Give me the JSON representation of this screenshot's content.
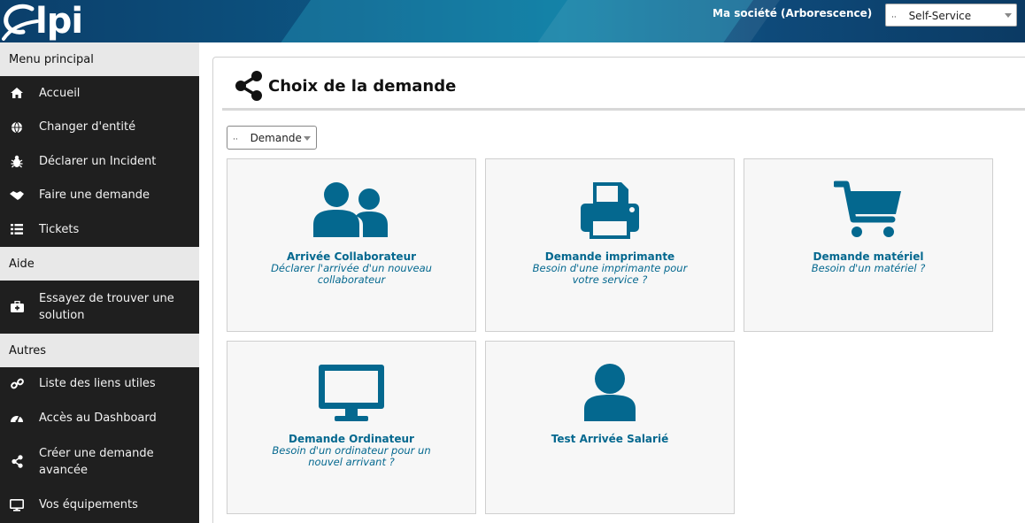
{
  "header": {
    "logo_text": "lpi",
    "entity": "Ma société (Arborescence)",
    "profile": {
      "dots": "··",
      "value": "Self-Service"
    }
  },
  "sidebar": {
    "sections": [
      {
        "title": "Menu principal",
        "items": [
          {
            "label": "Accueil",
            "icon": "home-icon"
          },
          {
            "label": "Changer d'entité",
            "icon": "globe-icon"
          },
          {
            "label": "Déclarer un Incident",
            "icon": "bug-icon"
          },
          {
            "label": "Faire une demande",
            "icon": "handshake-icon"
          },
          {
            "label": "Tickets",
            "icon": "list-icon"
          }
        ]
      },
      {
        "title": "Aide",
        "items": [
          {
            "label": "Essayez de trouver une solution",
            "icon": "medkit-icon"
          }
        ]
      },
      {
        "title": "Autres",
        "items": [
          {
            "label": "Liste des liens utiles",
            "icon": "link-icon"
          },
          {
            "label": "Accès au Dashboard",
            "icon": "dashboard-icon"
          },
          {
            "label": "Créer une demande avancée",
            "icon": "share-icon"
          },
          {
            "label": "Vos équipements",
            "icon": "monitor-icon"
          }
        ]
      }
    ]
  },
  "main": {
    "title": "Choix de la demande",
    "type_select": {
      "dots": "··",
      "value": "Demande"
    },
    "tiles": [
      {
        "name": "Arrivée Collaborateur",
        "desc": "Déclarer l'arrivée d'un nouveau collaborateur",
        "icon": "users-icon"
      },
      {
        "name": "Demande imprimante",
        "desc": "Besoin d'une imprimante pour votre service ?",
        "icon": "printer-icon"
      },
      {
        "name": "Demande matériel",
        "desc": "Besoin d'un matériel ?",
        "icon": "cart-icon"
      },
      {
        "name": "Demande Ordinateur",
        "desc": "Besoin d'un ordinateur pour un nouvel arrivant ?",
        "icon": "desktop-icon"
      },
      {
        "name": "Test Arrivée Salarié",
        "desc": "",
        "icon": "user-icon"
      }
    ]
  },
  "colors": {
    "accent": "#04688f",
    "sidebar_bg": "#1f1f1f",
    "section_bg": "#e8e8e8"
  }
}
